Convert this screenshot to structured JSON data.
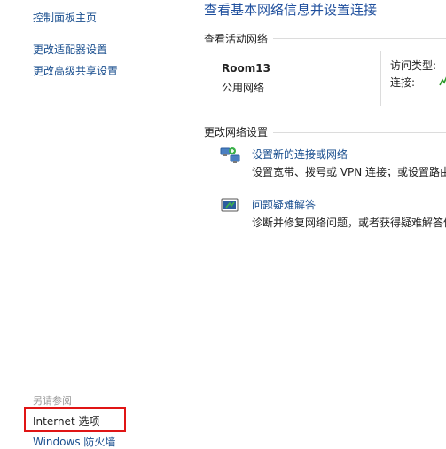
{
  "sidebar": {
    "items": [
      {
        "label": "控制面板主页"
      },
      {
        "label": "更改适配器设置"
      },
      {
        "label": "更改高级共享设置"
      }
    ],
    "see_also_title": "另请参阅",
    "see_also_items": [
      {
        "label": "Internet 选项"
      },
      {
        "label": "Windows 防火墙"
      }
    ],
    "highlight_color": "#e01515"
  },
  "main": {
    "title": "查看基本网络信息并设置连接",
    "active_networks": {
      "section_title": "查看活动网络",
      "network_name": "Room13",
      "network_type": "公用网络",
      "access_type_label": "访问类型:",
      "connection_label": "连接:"
    },
    "change_settings": {
      "section_title": "更改网络设置",
      "actions": [
        {
          "icon": "network-setup-icon",
          "title": "设置新的连接或网络",
          "description": "设置宽带、拨号或 VPN 连接；或设置路由"
        },
        {
          "icon": "troubleshoot-icon",
          "title": "问题疑难解答",
          "description": "诊断并修复网络问题，或者获得疑难解答信"
        }
      ]
    }
  },
  "colors": {
    "link": "#1a4f8f",
    "heading": "#1f4f9d"
  }
}
